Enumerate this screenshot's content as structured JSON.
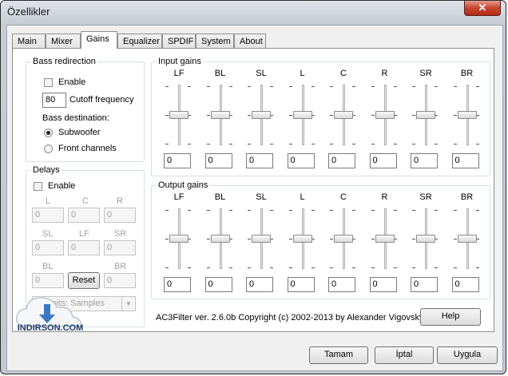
{
  "window": {
    "title": "Özellikler",
    "close_glyph": "✕"
  },
  "tabs": [
    {
      "label": "Main",
      "active": false
    },
    {
      "label": "Mixer",
      "active": false
    },
    {
      "label": "Gains",
      "active": true
    },
    {
      "label": "Equalizer",
      "active": false
    },
    {
      "label": "SPDIF",
      "active": false
    },
    {
      "label": "System",
      "active": false
    },
    {
      "label": "About",
      "active": false
    }
  ],
  "bass": {
    "title": "Bass redirection",
    "enable_label": "Enable",
    "enable_checked": false,
    "cutoff_value": "80",
    "cutoff_label": "Cutoff frequency",
    "dest_label": "Bass destination:",
    "opt_subwoofer": "Subwoofer",
    "opt_front": "Front channels",
    "selected": "Subwoofer"
  },
  "delays": {
    "title": "Delays",
    "enable_label": "Enable",
    "enable_checked": false,
    "labels": {
      "L": "L",
      "C": "C",
      "R": "R",
      "SL": "SL",
      "LF": "LF",
      "SR": "SR",
      "BL": "BL",
      "BR": "BR"
    },
    "values": {
      "L": "0",
      "C": "0",
      "R": "0",
      "SL": "0",
      "LF": "0",
      "SR": "0",
      "BL": "0",
      "BR": "0"
    },
    "reset_label": "Reset",
    "units_text": "Units: Samples"
  },
  "input_gains": {
    "title": "Input gains",
    "channels": [
      "LF",
      "BL",
      "SL",
      "L",
      "C",
      "R",
      "SR",
      "BR"
    ],
    "values": [
      "0",
      "0",
      "0",
      "0",
      "0",
      "0",
      "0",
      "0"
    ]
  },
  "output_gains": {
    "title": "Output gains",
    "channels": [
      "LF",
      "BL",
      "SL",
      "L",
      "C",
      "R",
      "SR",
      "BR"
    ],
    "values": [
      "0",
      "0",
      "0",
      "0",
      "0",
      "0",
      "0",
      "0"
    ]
  },
  "copyright": "AC3Filter ver. 2.6.0b Copyright (c) 2002-2013 by Alexander Vigovsky",
  "help_label": "Help",
  "buttons": {
    "ok": "Tamam",
    "cancel": "İptal",
    "apply": "Uygula"
  },
  "watermark": {
    "text": "INDIRSON.COM"
  },
  "colors": {
    "close": "#c7452f",
    "accent": "#3a78c4"
  }
}
